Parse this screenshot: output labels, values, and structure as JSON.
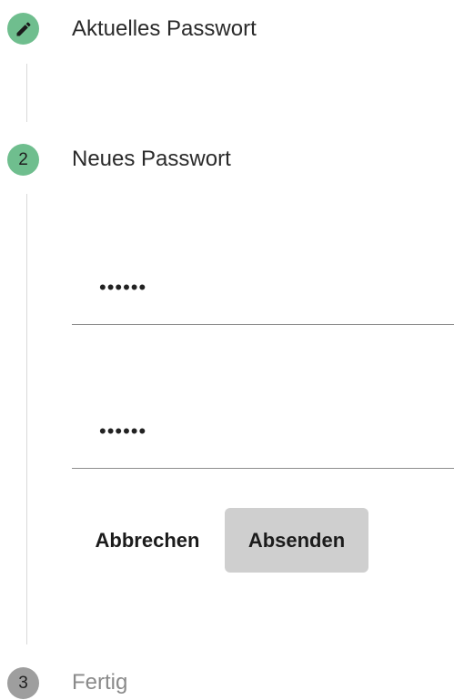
{
  "steps": [
    {
      "number": "",
      "label": "Aktuelles Passwort",
      "state": "done",
      "icon": "pencil-icon"
    },
    {
      "number": "2",
      "label": "Neues Passwort",
      "state": "active"
    },
    {
      "number": "3",
      "label": "Fertig",
      "state": "inactive"
    }
  ],
  "form": {
    "new_password_value": "••••••",
    "confirm_password_value": "••••••"
  },
  "actions": {
    "cancel_label": "Abbrechen",
    "submit_label": "Absenden"
  },
  "colors": {
    "step_done": "#6fbe8e",
    "step_active": "#6fbe8e",
    "step_inactive": "#9e9e9e",
    "submit_bg": "#cfcfcf"
  }
}
